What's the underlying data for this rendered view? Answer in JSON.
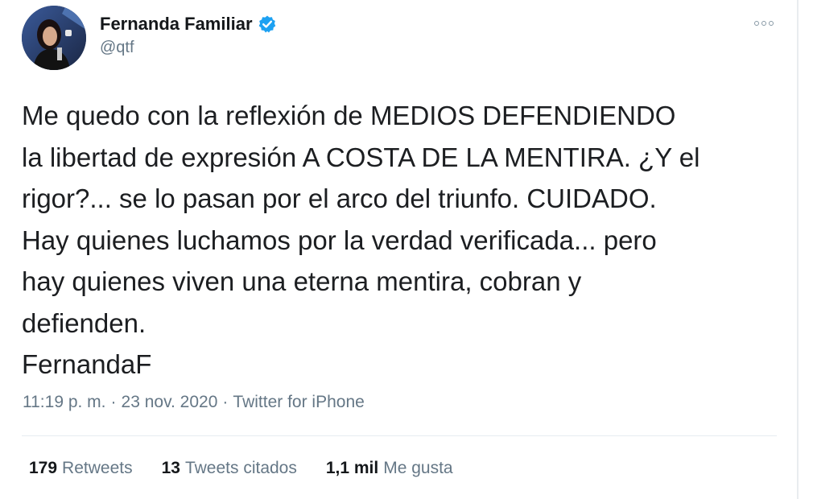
{
  "author": {
    "name": "Fernanda Familiar",
    "handle": "@qtf",
    "verified": true
  },
  "tweet": {
    "text": "Me quedo con la reflexión de MEDIOS DEFENDIENDO\nla libertad de expresión A COSTA DE LA MENTIRA. ¿Y el\nrigor?... se lo pasan por el arco del triunfo. CUIDADO.\nHay quienes luchamos por la verdad verificada... pero\nhay quienes viven una eterna mentira, cobran y\ndefienden.\nFernandaF"
  },
  "meta": {
    "time": "11:19 p. m.",
    "separator1": "·",
    "date": "23 nov. 2020",
    "separator2": "·",
    "source": "Twitter for iPhone"
  },
  "stats": {
    "retweets_count": "179",
    "retweets_label": "Retweets",
    "quotes_count": "13",
    "quotes_label": "Tweets citados",
    "likes_count": "1,1 mil",
    "likes_label": "Me gusta"
  },
  "icons": {
    "verified": "verified-badge-icon",
    "more": "more-options-icon"
  },
  "colors": {
    "accent": "#1da1f2",
    "text": "#14171a",
    "secondary": "#657786"
  }
}
